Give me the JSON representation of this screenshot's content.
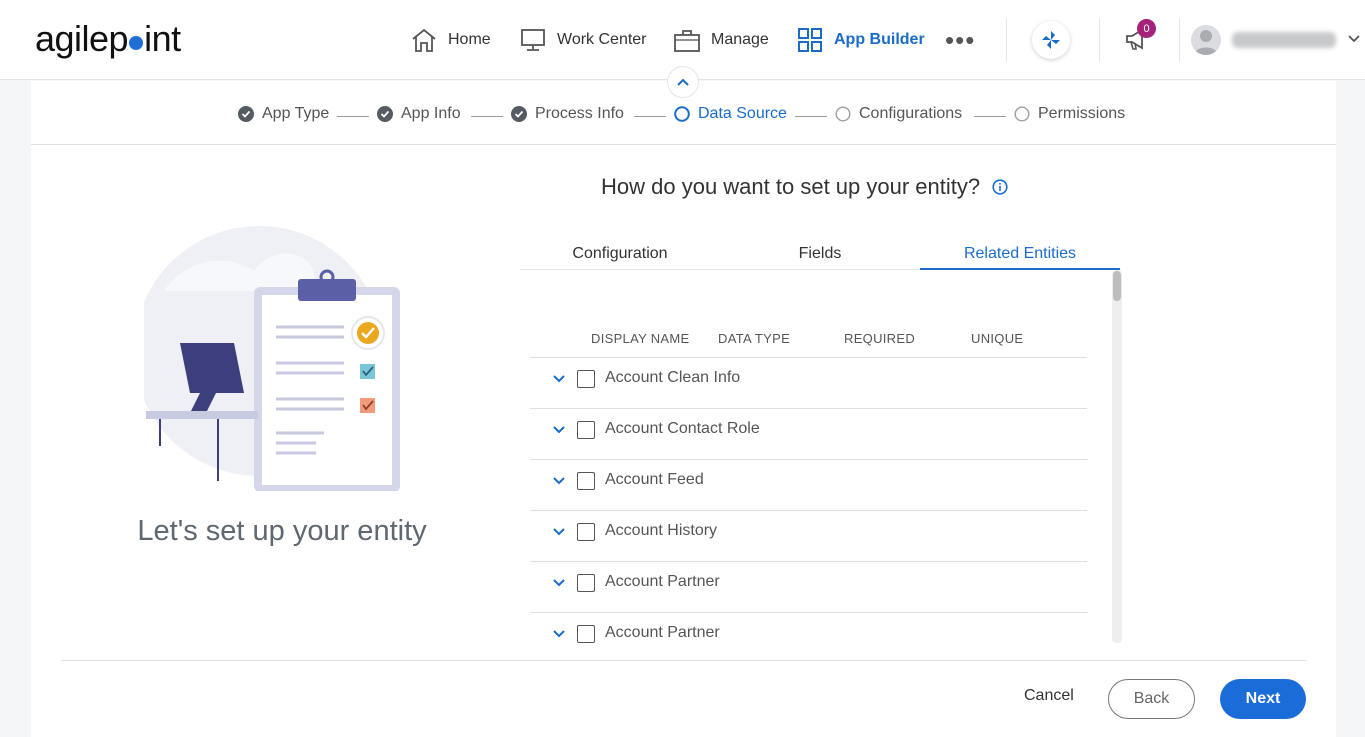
{
  "header": {
    "logo_pre": "agilep",
    "logo_post": "int",
    "nav": [
      {
        "label": "Home",
        "icon": "home-icon"
      },
      {
        "label": "Work Center",
        "icon": "monitor-icon"
      },
      {
        "label": "Manage",
        "icon": "briefcase-icon"
      },
      {
        "label": "App Builder",
        "icon": "grid-icon"
      }
    ],
    "more": "•••",
    "notification_count": "0"
  },
  "stepper": {
    "steps": [
      {
        "label": "App Type",
        "state": "done"
      },
      {
        "label": "App Info",
        "state": "done"
      },
      {
        "label": "Process Info",
        "state": "done"
      },
      {
        "label": "Data Source",
        "state": "current"
      },
      {
        "label": "Configurations",
        "state": "pending"
      },
      {
        "label": "Permissions",
        "state": "pending"
      }
    ]
  },
  "left": {
    "tagline": "Let's set up your entity"
  },
  "main": {
    "question": "How do you want to set up your entity?",
    "tabs": [
      {
        "label": "Configuration"
      },
      {
        "label": "Fields"
      },
      {
        "label": "Related Entities",
        "active": true
      }
    ],
    "columns": [
      "DISPLAY NAME",
      "DATA TYPE",
      "REQUIRED",
      "UNIQUE"
    ],
    "rows": [
      {
        "name": "Account Clean Info"
      },
      {
        "name": "Account Contact Role"
      },
      {
        "name": "Account Feed"
      },
      {
        "name": "Account History"
      },
      {
        "name": "Account Partner"
      },
      {
        "name": "Account Partner"
      }
    ]
  },
  "footer": {
    "cancel": "Cancel",
    "back": "Back",
    "next": "Next"
  },
  "colors": {
    "accent": "#1a6cc8",
    "primary_button": "#1a6cd8",
    "badge": "#a3247a"
  }
}
